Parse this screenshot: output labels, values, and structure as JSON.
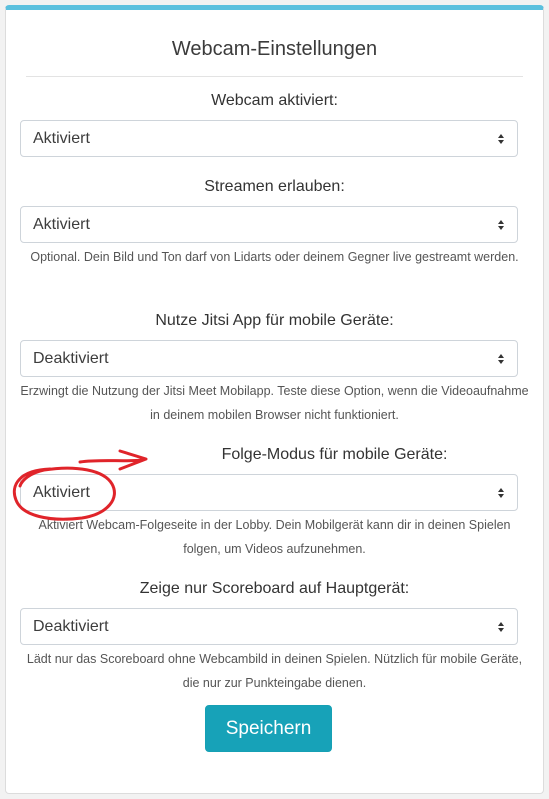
{
  "title": "Webcam-Einstellungen",
  "fields": [
    {
      "label": "Webcam aktiviert:",
      "value": "Aktiviert",
      "help": ""
    },
    {
      "label": "Streamen erlauben:",
      "value": "Aktiviert",
      "help": "Optional. Dein Bild und Ton darf von Lidarts oder deinem Gegner live gestreamt werden."
    },
    {
      "label": "Nutze Jitsi App für mobile Geräte:",
      "value": "Deaktiviert",
      "help": "Erzwingt die Nutzung der Jitsi Meet Mobilapp. Teste diese Option, wenn die Videoaufnahme in deinem mobilen Browser nicht funktioniert."
    },
    {
      "label": "Folge-Modus für mobile Geräte:",
      "value": "Aktiviert",
      "help": "Aktiviert Webcam-Folgeseite in der Lobby. Dein Mobilgerät kann dir in deinen Spielen folgen, um Videos aufzunehmen."
    },
    {
      "label": "Zeige nur Scoreboard auf Hauptgerät:",
      "value": "Deaktiviert",
      "help": "Lädt nur das Scoreboard ohne Webcambild in deinen Spielen. Nützlich für mobile Geräte, die nur zur Punkteingabe dienen."
    }
  ],
  "save_label": "Speichern",
  "colors": {
    "accent": "#17a2b8",
    "top_border": "#5bc0de",
    "annotation": "#e0242a"
  },
  "icons": [
    "select-arrows-icon",
    "annotation-arrow",
    "annotation-circle"
  ]
}
